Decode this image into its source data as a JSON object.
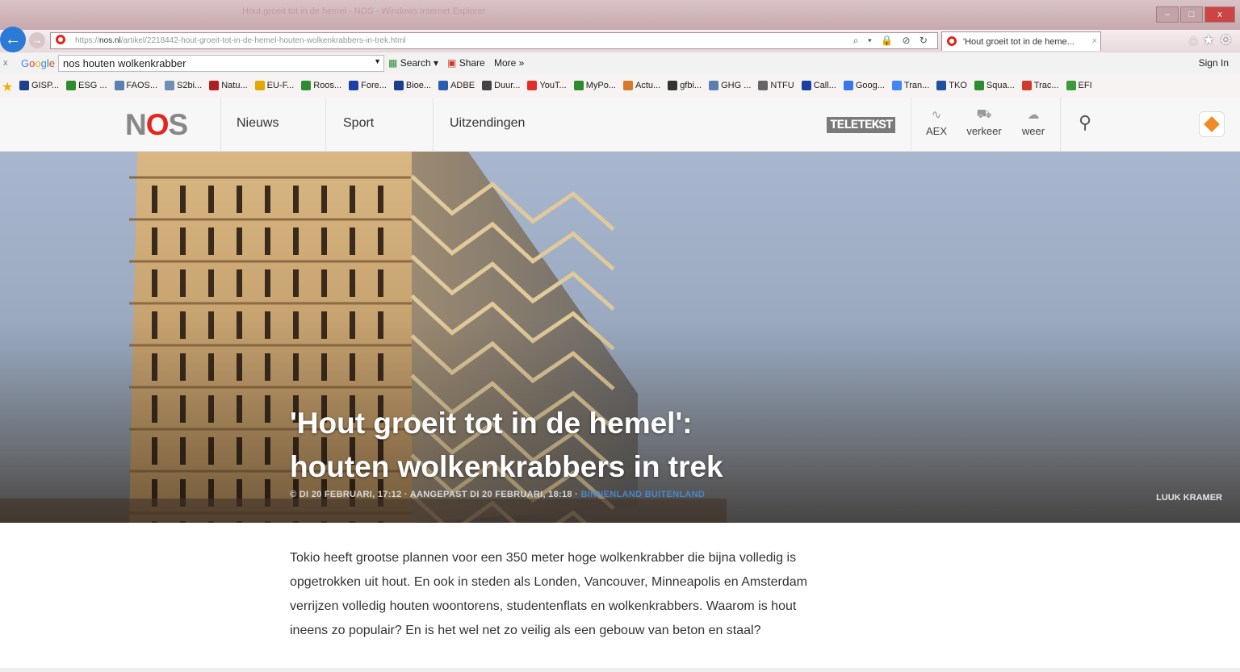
{
  "browser": {
    "title": "Hout groeit tot in de hemel - NOS - Windows Internet Explorer",
    "url_prefix": "https://",
    "url_host": "nos.nl",
    "url_path": "/artikel/2218442-hout-groeit-tot-in-de-hemel-houten-wolkenkrabbers-in-trek.html",
    "tab_label": "'Hout groeit tot in de heme...",
    "tab_close": "×",
    "back": "←",
    "forward": "→",
    "addr_tools": "⌕ ▾ 🔒 ⊘ ↻",
    "ie_tools": "⌂★⚙"
  },
  "google_toolbar": {
    "close": "x",
    "logo": "Google",
    "query": "nos houten wolkenkrabber",
    "search_label": "Search",
    "share_label": "Share",
    "more_label": "More »",
    "sign_in": "Sign In"
  },
  "favorites": [
    {
      "label": "GISP...",
      "color": "#1f3f8f"
    },
    {
      "label": "ESG ...",
      "color": "#2e8b2e"
    },
    {
      "label": "FAOS...",
      "color": "#5a7fb0"
    },
    {
      "label": "S2bi...",
      "color": "#6f8fb5"
    },
    {
      "label": "Natu...",
      "color": "#b01e1e"
    },
    {
      "label": "EU-F...",
      "color": "#e0a800"
    },
    {
      "label": "Roos...",
      "color": "#2e8b2e"
    },
    {
      "label": "Fore...",
      "color": "#1d3fa8"
    },
    {
      "label": "Bioe...",
      "color": "#1d3f8a"
    },
    {
      "label": "ADBE",
      "color": "#2a5db0"
    },
    {
      "label": "Duur...",
      "color": "#444444"
    },
    {
      "label": "YouT...",
      "color": "#e52d27"
    },
    {
      "label": "MyPo...",
      "color": "#2e8b2e"
    },
    {
      "label": "Actu...",
      "color": "#d47a2a"
    },
    {
      "label": "gfbi...",
      "color": "#333333"
    },
    {
      "label": "GHG ...",
      "color": "#5a7fb0"
    },
    {
      "label": "NTFU",
      "color": "#666666"
    },
    {
      "label": "Call...",
      "color": "#1a3fa0"
    },
    {
      "label": "Goog...",
      "color": "#3b78e7"
    },
    {
      "label": "Tran...",
      "color": "#4285f4"
    },
    {
      "label": "TKO",
      "color": "#1f4fa0"
    },
    {
      "label": "Squa...",
      "color": "#2e8b2e"
    },
    {
      "label": "Trac...",
      "color": "#d03a2a"
    },
    {
      "label": "EFI",
      "color": "#3a9b3a"
    }
  ],
  "nos": {
    "logo_n": "N",
    "logo_o": "O",
    "logo_s": "S",
    "nav": [
      "Nieuws",
      "Sport",
      "Uitzendingen"
    ],
    "teletekst": "TELETEKST",
    "aex": "AEX",
    "verkeer": "verkeer",
    "weer": "weer"
  },
  "article": {
    "headline_line1": "'Hout groeit tot in de hemel':",
    "headline_line2": "houten wolkenkrabbers in trek",
    "meta_date": "© DI 20 FEBRUARI, 17:12",
    "meta_updated": "AANGEPAST DI 20 FEBRUARI, 18:18",
    "meta_category": "BINNENLAND BUITENLAND",
    "photo_credit": "LUUK KRAMER",
    "body": "Tokio heeft grootse plannen voor een 350 meter hoge wolkenkrabber die bijna volledig is opgetrokken uit hout. En ook in steden als Londen, Vancouver, Minneapolis en Amsterdam verrijzen volledig houten woontorens, studentenflats en wolkenkrabbers. Waarom is hout ineens zo populair? En is het wel net zo veilig als een gebouw van beton en staal?"
  },
  "colors": {
    "nos_red": "#e1261c",
    "ie_blue": "#2a7ad6",
    "category_blue": "#4a86c8"
  }
}
